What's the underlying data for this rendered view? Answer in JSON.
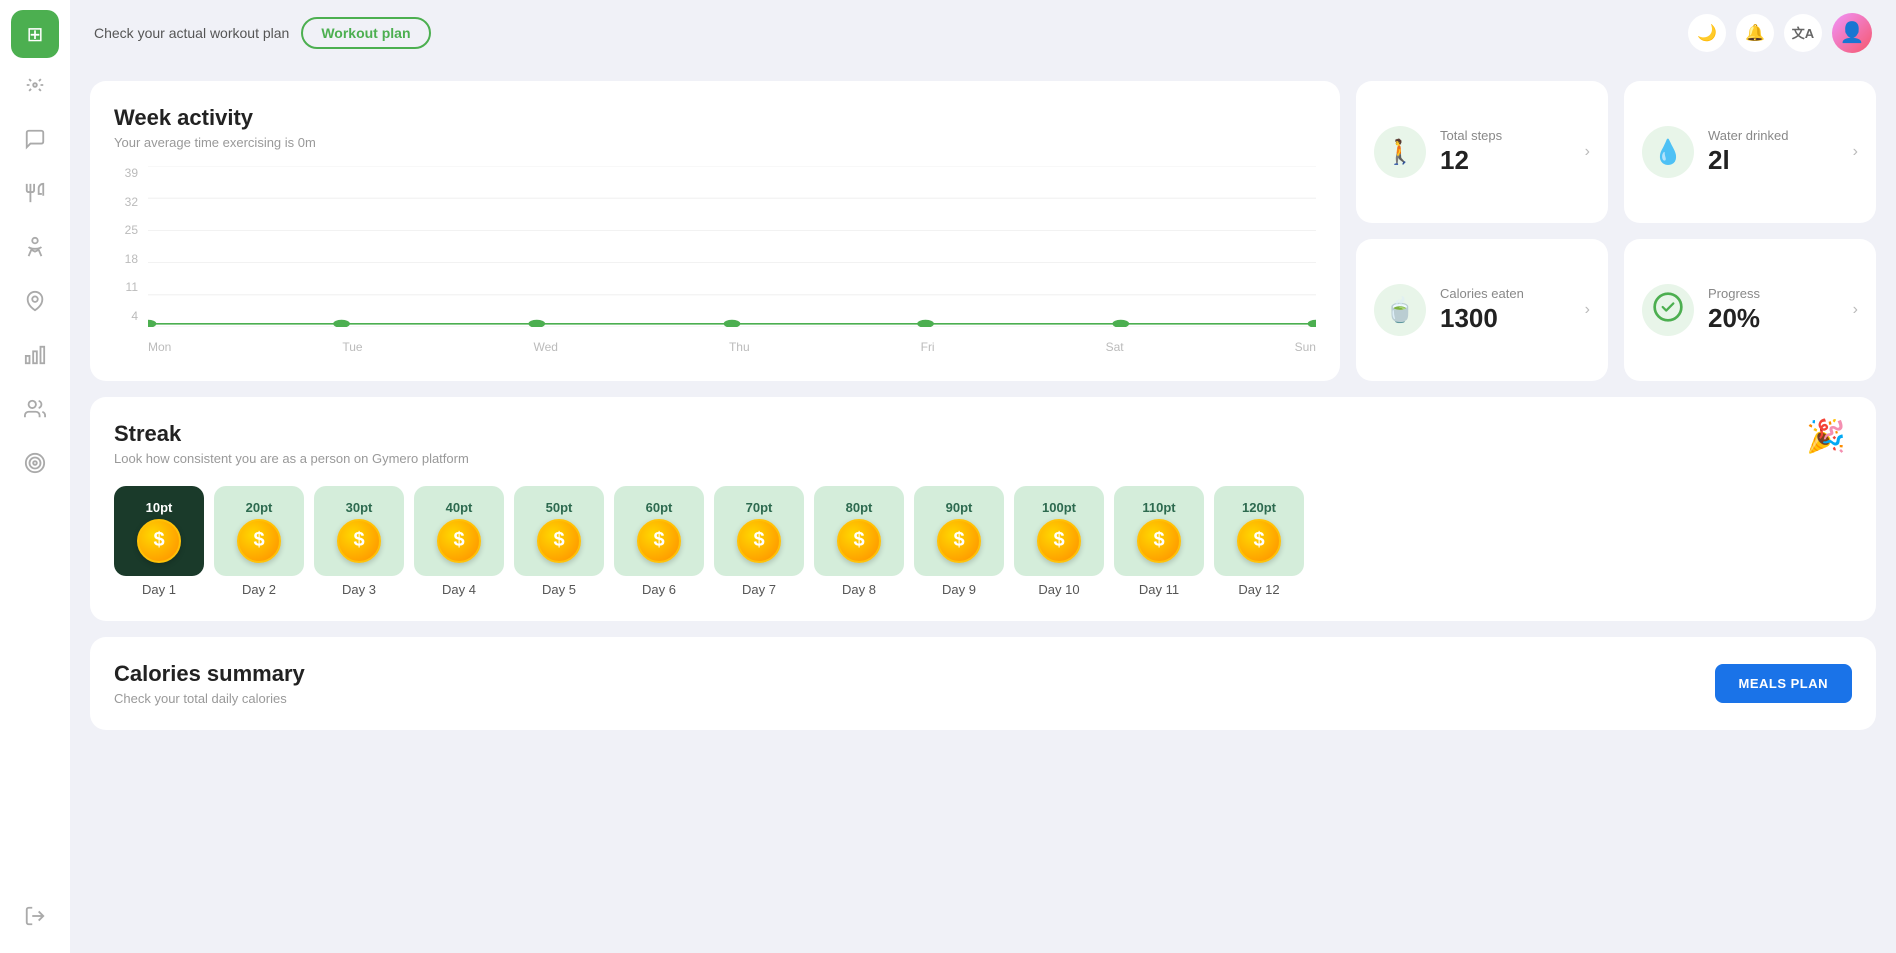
{
  "topbar": {
    "check_text": "Check your actual workout plan",
    "workout_btn": "Workout plan"
  },
  "sidebar": {
    "items": [
      {
        "id": "dashboard",
        "icon": "⊞",
        "active": true
      },
      {
        "id": "workout",
        "icon": "🏋"
      },
      {
        "id": "chat",
        "icon": "💬"
      },
      {
        "id": "nutrition",
        "icon": "🍴"
      },
      {
        "id": "yoga",
        "icon": "🧘"
      },
      {
        "id": "location",
        "icon": "📍"
      },
      {
        "id": "chart",
        "icon": "📊"
      },
      {
        "id": "people",
        "icon": "👥"
      },
      {
        "id": "target",
        "icon": "🎯"
      }
    ],
    "bottom": [
      {
        "id": "logout",
        "icon": "↗"
      }
    ]
  },
  "week_activity": {
    "title": "Week activity",
    "subtitle": "Your average time exercising is 0m",
    "y_labels": [
      "39",
      "32",
      "25",
      "18",
      "11",
      "4"
    ],
    "x_labels": [
      "Mon",
      "Tue",
      "Wed",
      "Thu",
      "Fri",
      "Sat",
      "Sun"
    ],
    "data_points": [
      4,
      4,
      4,
      4,
      4,
      4,
      4
    ]
  },
  "stats": [
    {
      "label": "Total steps",
      "value": "12",
      "icon": "🚶",
      "icon_bg": "#e8f5e9"
    },
    {
      "label": "Water drinked",
      "value": "2l",
      "icon": "💧",
      "icon_bg": "#e8f5e9"
    },
    {
      "label": "Calories eaten",
      "value": "1300",
      "icon": "🍵",
      "icon_bg": "#e8f5e9"
    },
    {
      "label": "Progress",
      "value": "20%",
      "icon": "✅",
      "icon_bg": "#e8f5e9"
    }
  ],
  "streak": {
    "title": "Streak",
    "subtitle": "Look how consistent you are as a person on Gymero platform",
    "emoji": "🎉",
    "items": [
      {
        "pts": "10pt",
        "day": "Day 1",
        "active": true
      },
      {
        "pts": "20pt",
        "day": "Day 2",
        "active": false
      },
      {
        "pts": "30pt",
        "day": "Day 3",
        "active": false
      },
      {
        "pts": "40pt",
        "day": "Day 4",
        "active": false
      },
      {
        "pts": "50pt",
        "day": "Day 5",
        "active": false
      },
      {
        "pts": "60pt",
        "day": "Day 6",
        "active": false
      },
      {
        "pts": "70pt",
        "day": "Day 7",
        "active": false
      },
      {
        "pts": "80pt",
        "day": "Day 8",
        "active": false
      },
      {
        "pts": "90pt",
        "day": "Day 9",
        "active": false
      },
      {
        "pts": "100pt",
        "day": "Day 10",
        "active": false
      },
      {
        "pts": "110pt",
        "day": "Day 11",
        "active": false
      },
      {
        "pts": "120pt",
        "day": "Day 12",
        "active": false
      }
    ]
  },
  "calories_summary": {
    "title": "Calories summary",
    "subtitle": "Check your total daily calories",
    "btn_label": "MEALS PLAN"
  }
}
